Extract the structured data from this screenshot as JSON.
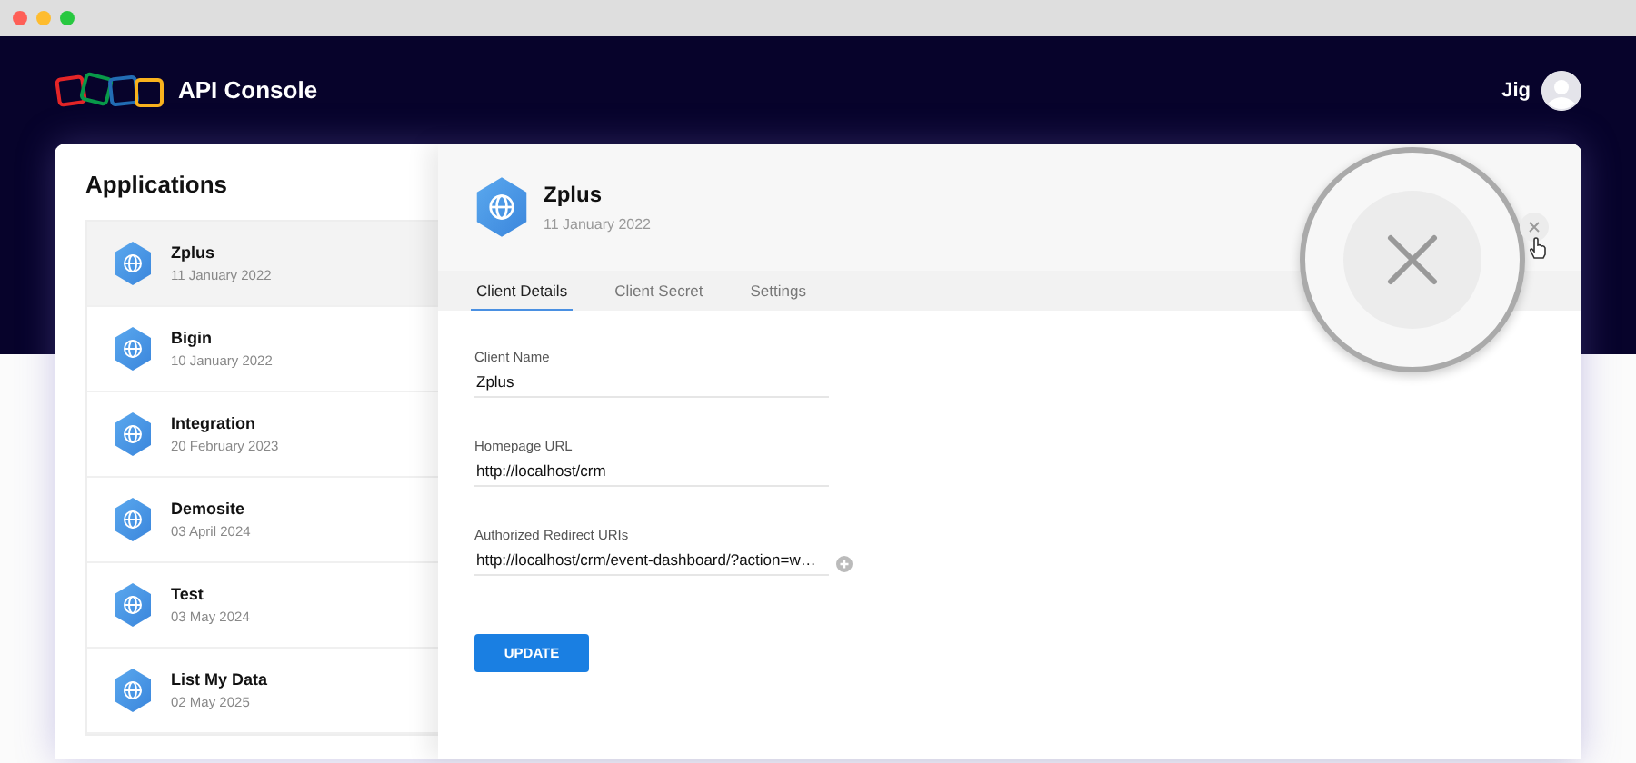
{
  "header": {
    "title": "API Console",
    "user": "Jig"
  },
  "applications": {
    "title": "Applications",
    "items": [
      {
        "name": "Zplus",
        "date": "11 January 2022",
        "selected": true
      },
      {
        "name": "Bigin",
        "date": "10 January 2022",
        "selected": false
      },
      {
        "name": "Integration",
        "date": "20 February 2023",
        "selected": false
      },
      {
        "name": "Demosite",
        "date": "03 April 2024",
        "selected": false
      },
      {
        "name": "Test",
        "date": "03 May 2024",
        "selected": false
      },
      {
        "name": "List My Data",
        "date": "02 May 2025",
        "selected": false
      }
    ]
  },
  "detail": {
    "name": "Zplus",
    "date": "11 January 2022",
    "tabs": [
      {
        "label": "Client Details",
        "selected": true
      },
      {
        "label": "Client Secret",
        "selected": false
      },
      {
        "label": "Settings",
        "selected": false
      }
    ],
    "fields": [
      {
        "label": "Client Name",
        "value": "Zplus",
        "kind": "text"
      },
      {
        "label": "Homepage URL",
        "value": "http://localhost/crm",
        "kind": "text"
      },
      {
        "label": "Authorized Redirect URIs",
        "value": "http://localhost/crm/event-dashboard/?action=w…",
        "kind": "list"
      }
    ],
    "button": "UPDATE"
  }
}
